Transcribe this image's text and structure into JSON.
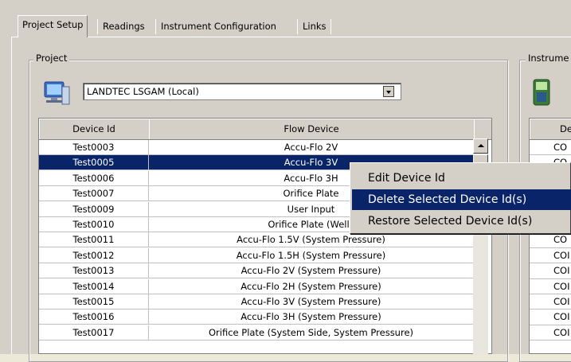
{
  "tabs": [
    "Project Setup",
    "Readings",
    "Instrument Configuration",
    "Links"
  ],
  "project_group": {
    "label": "Project",
    "icon": "computer-icon",
    "combo_value": "LANDTEC LSGAM (Local)"
  },
  "instrument_group": {
    "label": "Instrume",
    "icon": "handheld-instrument-icon"
  },
  "grid": {
    "columns": [
      "Device Id",
      "Flow Device"
    ],
    "rows": [
      {
        "id": "Test0003",
        "flow": "Accu-Flo 2V"
      },
      {
        "id": "Test0005",
        "flow": "Accu-Flo 3V"
      },
      {
        "id": "Test0006",
        "flow": "Accu-Flo 3H"
      },
      {
        "id": "Test0007",
        "flow": "Orifice Plate"
      },
      {
        "id": "Test0009",
        "flow": "User Input"
      },
      {
        "id": "Test0010",
        "flow": "Orifice Plate (Wells"
      },
      {
        "id": "Test0011",
        "flow": "Accu-Flo 1.5V (System Pressure)"
      },
      {
        "id": "Test0012",
        "flow": "Accu-Flo 1.5H (System Pressure)"
      },
      {
        "id": "Test0013",
        "flow": "Accu-Flo 2V (System Pressure)"
      },
      {
        "id": "Test0014",
        "flow": "Accu-Flo 2H (System Pressure)"
      },
      {
        "id": "Test0015",
        "flow": "Accu-Flo 3V (System Pressure)"
      },
      {
        "id": "Test0016",
        "flow": "Accu-Flo 3H (System Pressure)"
      },
      {
        "id": "Test0017",
        "flow": "Orifice Plate (System Side, System Pressure)"
      }
    ],
    "selected_index": 1
  },
  "grid2": {
    "header": "De",
    "rows": [
      "CO",
      "CO",
      "",
      "",
      "",
      "",
      "CO",
      "COI",
      "COI",
      "COI",
      "COI",
      "COI",
      "COI"
    ]
  },
  "context_menu": {
    "items": [
      "Edit Device Id",
      "Delete Selected Device Id(s)",
      "Restore Selected Device Id(s)"
    ],
    "highlighted_index": 1
  },
  "colors": {
    "selection": "#0a246a",
    "face": "#d4d0c8"
  }
}
